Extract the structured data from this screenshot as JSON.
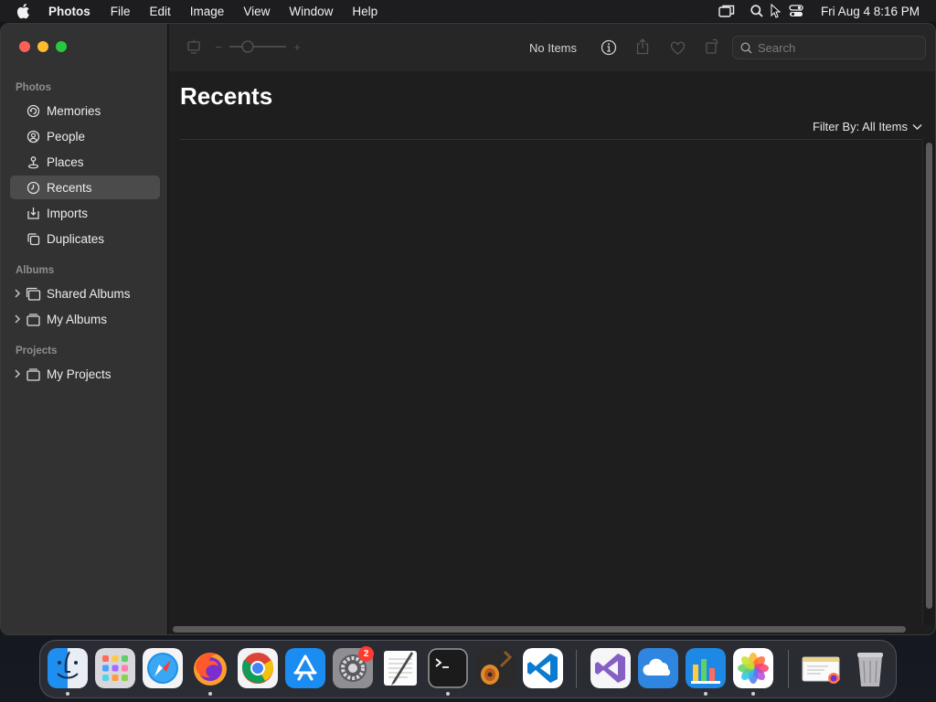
{
  "menubar": {
    "app_name": "Photos",
    "menus": [
      "File",
      "Edit",
      "Image",
      "View",
      "Window",
      "Help"
    ],
    "clock": "Fri Aug 4  8:16 PM"
  },
  "toolbar": {
    "status": "No Items",
    "search_placeholder": "Search",
    "zoom_minus": "−",
    "zoom_plus": "+"
  },
  "sidebar": {
    "sections": {
      "photos": "Photos",
      "albums": "Albums",
      "projects": "Projects"
    },
    "photos_items": [
      {
        "label": "Memories",
        "icon": "memories-icon"
      },
      {
        "label": "People",
        "icon": "people-icon"
      },
      {
        "label": "Places",
        "icon": "places-icon"
      },
      {
        "label": "Recents",
        "icon": "recents-icon",
        "selected": true
      },
      {
        "label": "Imports",
        "icon": "imports-icon"
      },
      {
        "label": "Duplicates",
        "icon": "duplicates-icon"
      }
    ],
    "album_items": [
      {
        "label": "Shared Albums",
        "icon": "shared-albums-icon"
      },
      {
        "label": "My Albums",
        "icon": "albums-icon"
      }
    ],
    "project_items": [
      {
        "label": "My Projects",
        "icon": "projects-icon"
      }
    ]
  },
  "main": {
    "title": "Recents",
    "filter_label": "Filter By: All Items"
  },
  "dock": {
    "apps": [
      "Finder",
      "Launchpad",
      "Safari",
      "Firefox",
      "Chrome",
      "App Store",
      "System Settings",
      "TextEdit",
      "Terminal",
      "GarageBand",
      "Visual Studio Code",
      "Visual Studio",
      "Weather",
      "Keynote",
      "Photos",
      "Preview",
      "Trash"
    ],
    "settings_badge": "2"
  },
  "colors": {
    "close": "#fe5f57",
    "minimize": "#febc2e",
    "maximize": "#28c840",
    "badge": "#ff3b30"
  }
}
